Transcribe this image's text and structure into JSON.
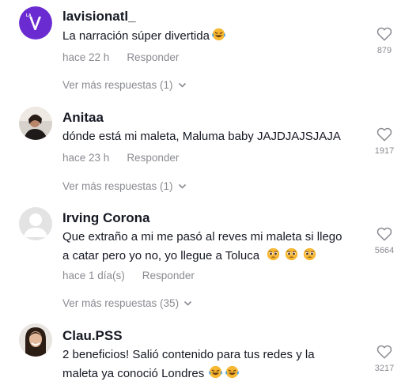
{
  "comments": [
    {
      "username": "lavisionatl_",
      "text": "La narración súper divertida",
      "emojis": [
        "laughing-tears"
      ],
      "time": "hace 22 h",
      "reply_label": "Responder",
      "likes": "879",
      "more_label": "Ver más respuestas (1)"
    },
    {
      "username": "Anitaa",
      "text": "dónde está mi maleta, Maluma baby JAJDJAJSJAJA",
      "emojis": [],
      "time": "hace 23 h",
      "reply_label": "Responder",
      "likes": "1917",
      "more_label": "Ver más respuestas (1)"
    },
    {
      "username": "Irving Corona",
      "text_line1": "Que extraño a mi me pasó al reves mi maleta si llego",
      "text_line2": "a catar pero yo no, yo llegue a Toluca",
      "emojis": [
        "pleading",
        "pleading",
        "pleading"
      ],
      "time": "hace 1 día(s)",
      "reply_label": "Responder",
      "likes": "5664",
      "more_label": "Ver más respuestas (35)"
    },
    {
      "username": "Clau.PSS",
      "text_line1": "2 beneficios! Salió contenido para tus redes y la",
      "text_line2": "maleta ya conoció Londres",
      "emojis": [
        "laughing-tears",
        "laughing-tears"
      ],
      "likes": "3217"
    }
  ],
  "colors": {
    "primary_text": "#161823",
    "secondary_text": "#8a8b91",
    "brand_purple": "#6a2bd1"
  }
}
